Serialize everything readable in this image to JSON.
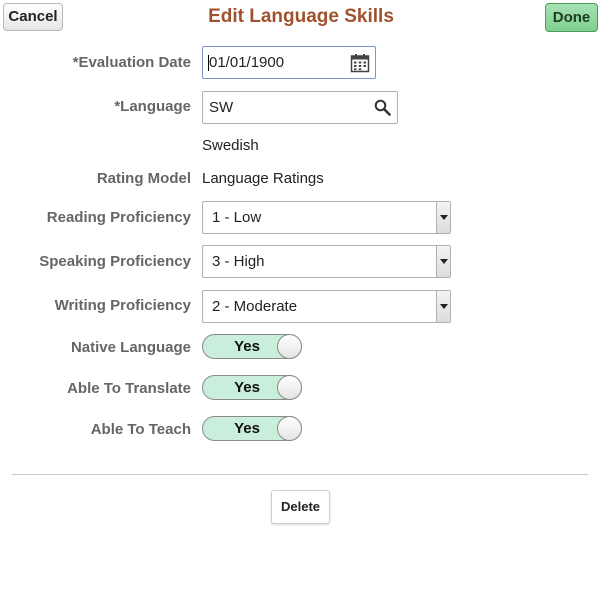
{
  "header": {
    "cancel_label": "Cancel",
    "title": "Edit Language Skills",
    "done_label": "Done"
  },
  "form": {
    "evaluation_date": {
      "label": "*Evaluation Date",
      "value": "01/01/1900"
    },
    "language": {
      "label": "*Language",
      "value": "SW",
      "description": "Swedish"
    },
    "rating_model": {
      "label": "Rating Model",
      "value": "Language Ratings"
    },
    "reading": {
      "label": "Reading Proficiency",
      "value": "1 - Low"
    },
    "speaking": {
      "label": "Speaking Proficiency",
      "value": "3 - High"
    },
    "writing": {
      "label": "Writing Proficiency",
      "value": "2 - Moderate"
    },
    "native": {
      "label": "Native Language",
      "value": "Yes"
    },
    "translate": {
      "label": "Able To Translate",
      "value": "Yes"
    },
    "teach": {
      "label": "Able To Teach",
      "value": "Yes"
    }
  },
  "footer": {
    "delete_label": "Delete"
  },
  "icons": {
    "calendar": "calendar-icon",
    "search": "search-icon",
    "dropdown": "chevron-down-icon"
  },
  "colors": {
    "title": "#a0522d",
    "done_button": "#8fd6a0",
    "toggle_on": "#c9eedb"
  }
}
